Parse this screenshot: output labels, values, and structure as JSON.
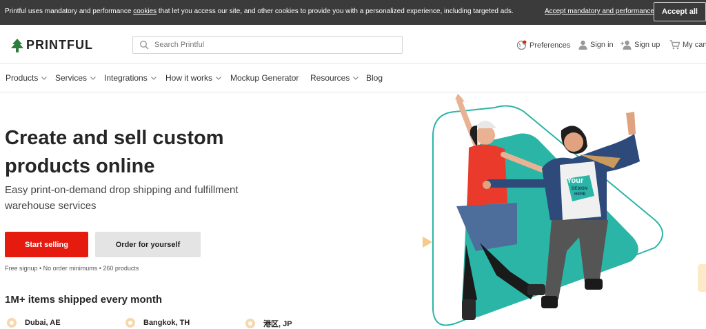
{
  "cookie_bar": {
    "text_before": "Printful uses mandatory and performance ",
    "link": "cookies",
    "text_after": " that let you access our site, and other cookies to provide you with a personalized experience, including targeted ads.",
    "accept_mandatory": "Accept mandatory and performance",
    "accept_all": "Accept all"
  },
  "header": {
    "logo": "PRINTFUL",
    "search_placeholder": "Search Printful",
    "links": {
      "preferences": "Preferences",
      "sign_in": "Sign in",
      "sign_up": "Sign up",
      "cart": "My cart"
    }
  },
  "nav": {
    "items": [
      {
        "label": "Products",
        "dropdown": true
      },
      {
        "label": "Services",
        "dropdown": true
      },
      {
        "label": "Integrations",
        "dropdown": true
      },
      {
        "label": "How it works",
        "dropdown": true
      },
      {
        "label": "Mockup Generator",
        "dropdown": false
      },
      {
        "label": "Resources",
        "dropdown": true
      },
      {
        "label": "Blog",
        "dropdown": false
      }
    ]
  },
  "hero": {
    "title_line1": "Create and sell custom",
    "title_line2": "products online",
    "subtitle_line1": "Easy print-on-demand drop shipping and fulfillment",
    "subtitle_line2": "warehouse services",
    "start_selling": "Start selling",
    "order_yourself": "Order for yourself",
    "facts": "Free signup • No order minimums • 260 products",
    "shipped": "1M+ items shipped every month",
    "locations": [
      "Dubai, AE",
      "Bangkok, TH",
      "港区, JP"
    ],
    "shirt_text_1": "Your",
    "shirt_text_2": "DESIGN",
    "shirt_text_3": "HERE"
  },
  "colors": {
    "primary": "#e51b0f",
    "teal": "#2bb5a6",
    "cookie_bg": "#3b3b3b"
  }
}
